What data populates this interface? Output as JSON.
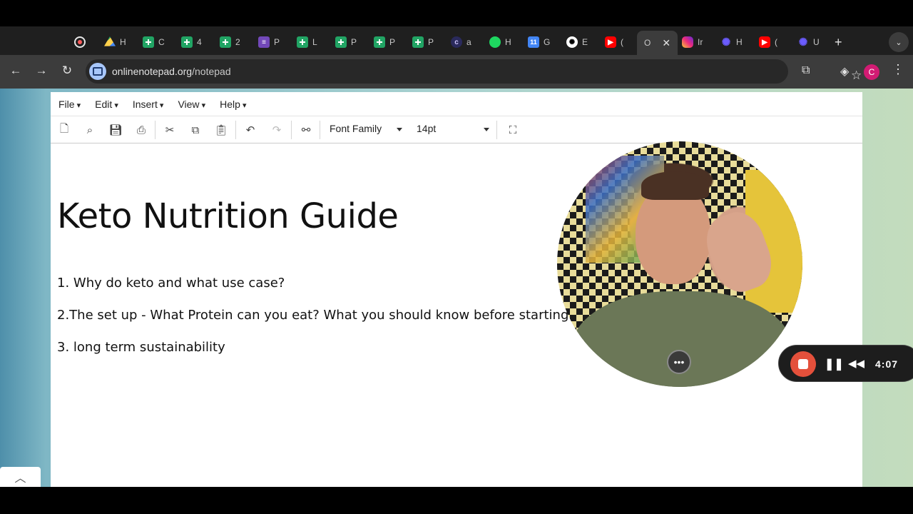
{
  "browser": {
    "tabs": [
      {
        "label": "",
        "icon": "recording-icon"
      },
      {
        "label": "H",
        "icon": "drive-icon"
      },
      {
        "label": "C",
        "icon": "sheets-icon"
      },
      {
        "label": "4",
        "icon": "sheets-icon"
      },
      {
        "label": "2",
        "icon": "sheets-icon"
      },
      {
        "label": "P",
        "icon": "forms-icon"
      },
      {
        "label": "L",
        "icon": "sheets-icon"
      },
      {
        "label": "P",
        "icon": "sheets-icon"
      },
      {
        "label": "P",
        "icon": "sheets-icon"
      },
      {
        "label": "P",
        "icon": "sheets-icon"
      },
      {
        "label": "a",
        "icon": "c-icon"
      },
      {
        "label": "H",
        "icon": "spotify-icon"
      },
      {
        "label": "G",
        "icon": "calendar-icon"
      },
      {
        "label": "E",
        "icon": "openai-icon"
      },
      {
        "label": "(",
        "icon": "youtube-icon"
      },
      {
        "label": "O",
        "icon": "",
        "active": true
      },
      {
        "label": "Ir",
        "icon": "instagram-icon"
      },
      {
        "label": "H",
        "icon": "star-icon"
      },
      {
        "label": "(",
        "icon": "youtube-icon"
      },
      {
        "label": "U",
        "icon": "star-icon"
      }
    ],
    "url_domain": "onlinenotepad.org",
    "url_path": "/notepad",
    "avatar_letter": "C"
  },
  "editor": {
    "menu": [
      "File",
      "Edit",
      "Insert",
      "View",
      "Help"
    ],
    "font_family": "Font Family",
    "font_size": "14pt"
  },
  "document": {
    "title": "Keto Nutrition Guide",
    "lines": [
      "1. Why do keto and what use case?",
      "2.The set up - What Protein can you eat? What you should know before starting",
      "3. long term sustainability"
    ]
  },
  "recorder": {
    "time": "4:07",
    "more_label": "•••"
  },
  "colors": {
    "stop": "#e4503b",
    "avatar": "#d21b73",
    "tab_bg": "#1f1f1f",
    "toolbar_bg": "#3c3c3c"
  }
}
